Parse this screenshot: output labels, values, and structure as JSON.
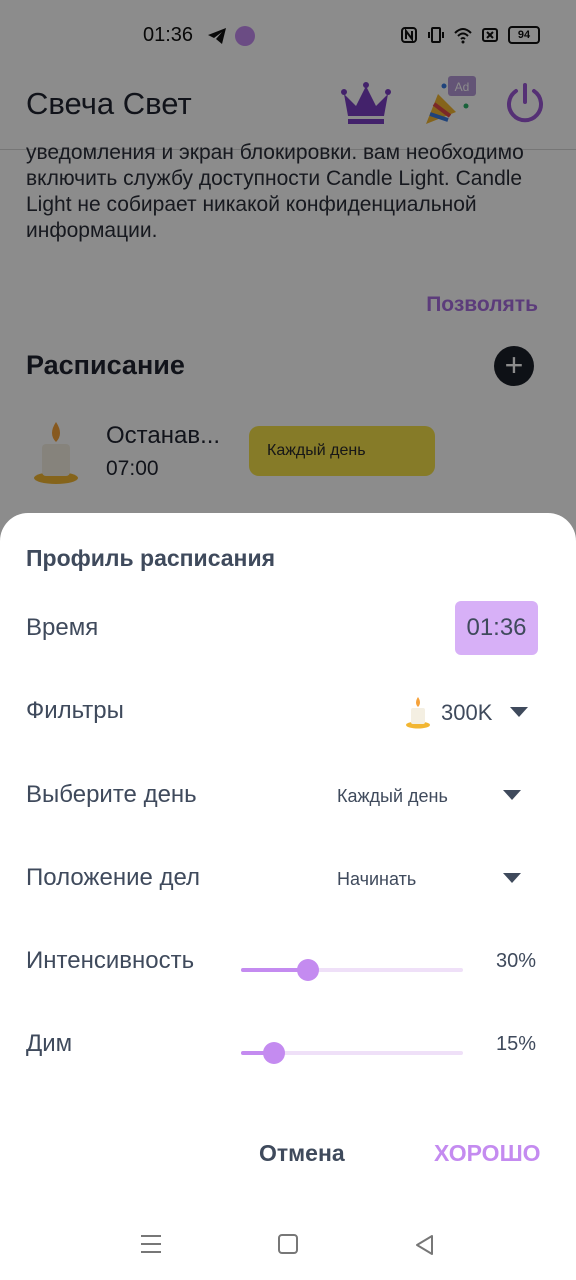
{
  "status_bar": {
    "time": "01:36",
    "battery": "94"
  },
  "app_bar": {
    "title": "Свеча Свет",
    "ad_badge": "Ad"
  },
  "intro_text": "уведомления и экран блокировки. вам необходимо включить службу доступности Candle Light. Candle Light не собирает никакой конфиденциальной информации.",
  "allow_link": "Позволять",
  "schedule": {
    "heading": "Расписание",
    "add_icon": "plus",
    "item": {
      "name": "Останав...",
      "time": "07:00",
      "day": "Каждый день"
    }
  },
  "sheet": {
    "title": "Профиль расписания",
    "time_label": "Время",
    "time_value": "01:36",
    "filters_label": "Фильтры",
    "filters_value": "300K",
    "day_label": "Выберите день",
    "day_value": "Каждый день",
    "action_label": "Положение дел",
    "action_value": "Начинать",
    "intensity_label": "Интенсивность",
    "intensity_value": "30%",
    "intensity_fraction": 0.3,
    "dim_label": "Дим",
    "dim_value": "15%",
    "dim_fraction": 0.15,
    "cancel_label": "Отмена",
    "ok_label": "ХОРОШО"
  },
  "colors": {
    "accent": "#c48bf0",
    "time_chip": "#d7b0f7",
    "chip_yellow": "#f4e04a",
    "text": "#3f4a5c"
  }
}
